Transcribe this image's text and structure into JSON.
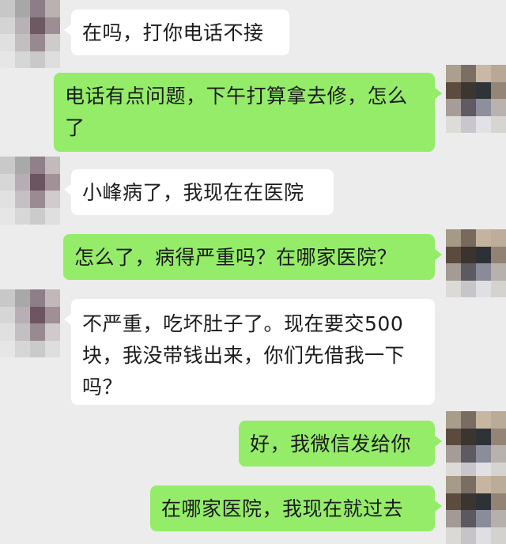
{
  "conversation": {
    "messages": [
      {
        "side": "in",
        "text": "在吗，打你电话不接"
      },
      {
        "side": "out",
        "text": "电话有点问题，下午打算拿去修，怎么了"
      },
      {
        "side": "in",
        "text": "小峰病了，我现在在医院"
      },
      {
        "side": "out",
        "text": "怎么了，病得严重吗？在哪家医院？"
      },
      {
        "side": "in",
        "text": "不严重，吃坏肚子了。现在要交500块，我没带钱出来，你们先借我一下吗？"
      },
      {
        "side": "out",
        "text": "好，我微信发给你"
      },
      {
        "side": "out",
        "text": "在哪家医院，我现在就过去"
      }
    ]
  },
  "colors": {
    "background": "#ececec",
    "incoming_bubble": "#ffffff",
    "outgoing_bubble": "#95ec69"
  },
  "avatars": {
    "contact": "pixelated-avatar",
    "self": "pixelated-avatar"
  }
}
